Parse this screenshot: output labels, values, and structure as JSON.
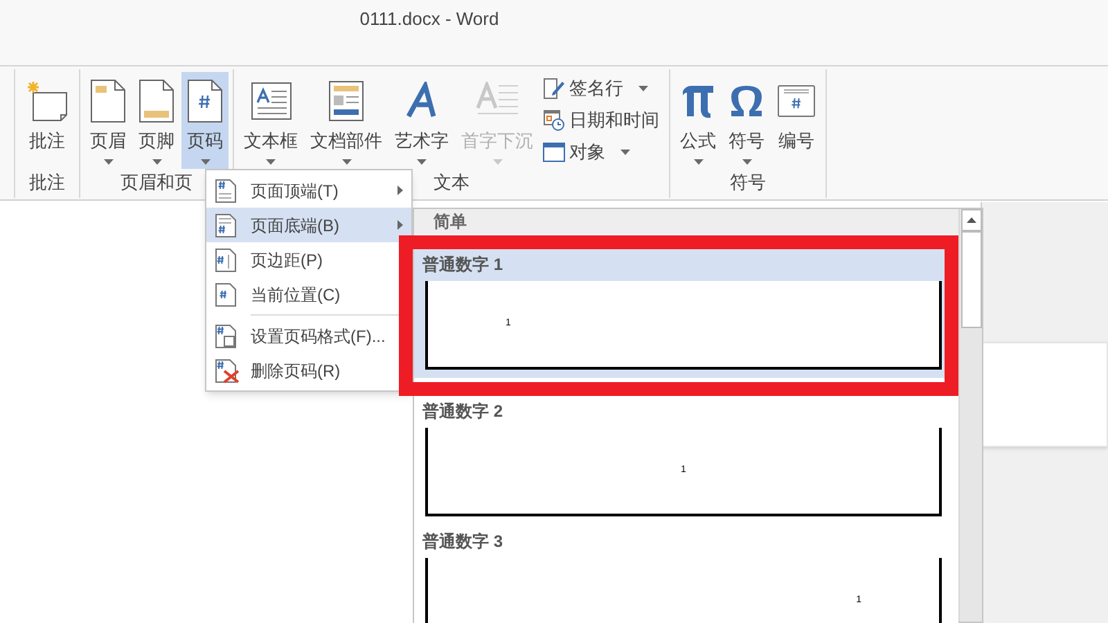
{
  "window": {
    "title": "0111.docx - Word"
  },
  "ribbon": {
    "groups": [
      {
        "label": "批注",
        "items": [
          {
            "kind": "large",
            "label": "批注",
            "dropdown": false,
            "selected": false,
            "disabled": false
          }
        ]
      },
      {
        "label": "页眉和页",
        "items": [
          {
            "kind": "large",
            "label": "页眉",
            "dropdown": true,
            "selected": false,
            "disabled": false
          },
          {
            "kind": "large",
            "label": "页脚",
            "dropdown": true,
            "selected": false,
            "disabled": false
          },
          {
            "kind": "large",
            "label": "页码",
            "dropdown": true,
            "selected": true,
            "disabled": false
          }
        ]
      },
      {
        "label": "文本",
        "items": [
          {
            "kind": "large",
            "label": "文本框",
            "dropdown": true,
            "selected": false,
            "disabled": false
          },
          {
            "kind": "large",
            "label": "文档部件",
            "dropdown": true,
            "selected": false,
            "disabled": false
          },
          {
            "kind": "large",
            "label": "艺术字",
            "dropdown": true,
            "selected": false,
            "disabled": false
          },
          {
            "kind": "large",
            "label": "首字下沉",
            "dropdown": true,
            "selected": false,
            "disabled": true
          },
          {
            "kind": "small",
            "label": "签名行",
            "dropdown": true,
            "selected": false,
            "disabled": false
          },
          {
            "kind": "small",
            "label": "日期和时间",
            "dropdown": false,
            "selected": false,
            "disabled": false
          },
          {
            "kind": "small",
            "label": "对象",
            "dropdown": true,
            "selected": false,
            "disabled": false
          }
        ]
      },
      {
        "label": "符号",
        "items": [
          {
            "kind": "large",
            "label": "公式",
            "dropdown": true,
            "selected": false,
            "disabled": false
          },
          {
            "kind": "large",
            "label": "符号",
            "dropdown": true,
            "selected": false,
            "disabled": false
          },
          {
            "kind": "large",
            "label": "编号",
            "dropdown": false,
            "selected": false,
            "disabled": false
          }
        ]
      }
    ]
  },
  "menu": {
    "items": [
      {
        "label": "页面顶端(T)",
        "submenu": true,
        "selected": false
      },
      {
        "label": "页面底端(B)",
        "submenu": true,
        "selected": true
      },
      {
        "label": "页边距(P)",
        "submenu": false,
        "selected": false
      },
      {
        "label": "当前位置(C)",
        "submenu": false,
        "selected": false
      },
      {
        "label": "设置页码格式(F)...",
        "submenu": false,
        "selected": false
      },
      {
        "label": "删除页码(R)",
        "submenu": false,
        "selected": false
      }
    ]
  },
  "gallery": {
    "header": "简单",
    "items": [
      {
        "label": "普通数字 1",
        "number": "1",
        "kind": "left",
        "selected": true
      },
      {
        "label": "普通数字 2",
        "number": "1",
        "kind": "center",
        "selected": false
      },
      {
        "label": "普通数字 3",
        "number": "1",
        "kind": "right",
        "selected": false
      }
    ]
  }
}
